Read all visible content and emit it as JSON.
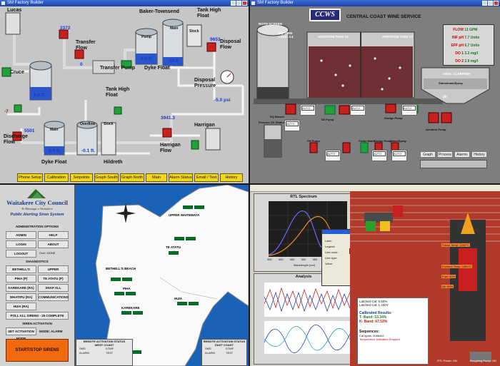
{
  "pane1": {
    "title": "SM Factory Builder",
    "labels": {
      "lucas": "Lucas",
      "baker": "Baker-Townsend",
      "tank_high_float_1": "Tank High\nFloat",
      "transfer_flow": "Transfer\nFlow",
      "disposal_flow": "Disposal\nFlow",
      "cruce": "Cruce",
      "transfer_pump": "Transfer Pump",
      "dyke_float_1": "Dyke Float",
      "tank_high_float_2": "Tank High\nFloat",
      "disposal_pressure": "Disposal\nPressure",
      "harrigan_flow": "Harrigan\nFlow",
      "harrigan": "Harrigan",
      "hildreth": "Hildreth",
      "discharge_flow": "Discharge\nFlow",
      "dyke_float_2": "Dyke Float",
      "main_1": "Main",
      "main_2": "Main",
      "overflow": "Overflow",
      "stock_1": "Stock",
      "stock_2": "Stock",
      "pump": "Pump"
    },
    "values": {
      "v2372": "2372",
      "v0": "0",
      "v9653": "9653",
      "v56": "5.6 ft.",
      "v60": "6.0 ft.",
      "v106": "10.6",
      "vneg50": "-5.0 psi",
      "v3941": "3941.3",
      "v5501": "5501",
      "v59": "5.9 ft.",
      "vneg01": "-0.1 ft.",
      "vneg7": "-7"
    },
    "buttons": [
      "Phone Setup",
      "Calibration",
      "Setpoints",
      "Graph South",
      "Graph North",
      "Main",
      "Alarm Status",
      "Email / Text",
      "History"
    ]
  },
  "pane2": {
    "title": "SM Factory Builder",
    "logo": "CCWS",
    "brand": "CENTRAL COAST WINE SERVICE",
    "tags": {
      "roto": "ROTO-SCREEN",
      "eq": "EQ TANK\nLevel: 3.4",
      "aer1": "AERATION TANK #1",
      "aer2": "AERATION TANK #2",
      "clarifier": "FINAL CLARIFIER",
      "sidestream": "Sidestream/Spray",
      "ph": "ph",
      "eq_blower": "EQ Blower",
      "proc_ox": "Process OX Station",
      "nit_pump": "N/I Pump",
      "sludge_pump": "Sludge Pump",
      "ph_pump": "PH Pump",
      "probe_maint": "Probe Maint",
      "sludge_pump2": "Sludge Pump",
      "slime_spray": "Slime/Spray",
      "aer_pump": "Aeration Pump"
    },
    "readings": [
      {
        "label": "FLOW",
        "value": "11 GPM"
      },
      {
        "label": "INF pH",
        "value": "7.7 Units"
      },
      {
        "label": "EFF pH",
        "value": "6.7 Units"
      },
      {
        "label": "DO 1",
        "value": "3.3 mg/l"
      },
      {
        "label": "DO 2",
        "value": "2.9 mg/l"
      }
    ],
    "nav": [
      "Graph",
      "Process",
      "Alarms",
      "History"
    ],
    "auto": "AUTO"
  },
  "pane3": {
    "org": "Waitakere City Council",
    "org_sub": "Te Rūnanga o Waitakere",
    "system": "Public Alerting Siren System",
    "admin_title": "ADMINISTRATION OPTIONS",
    "admin_buttons": [
      "ADMIN",
      "HELP",
      "LOGIN",
      "ABOUT",
      "LOGOUT",
      "Over: NONE"
    ],
    "diag_title": "DIAGNOSTICS",
    "diag_buttons": [
      "BETHELL'S BEACH (P)",
      "UPPER WAITEMATA (P)",
      "PIHA (P)",
      "TE ATATU (P)",
      "KAREKARE (RA)",
      "SNAP ALL",
      "WHATIPU (RA)",
      "COMMUNICATIONS",
      "HUIA (RA)",
      "POLL ALL SIRENS - 25 COMPLETE"
    ],
    "siren_title": "SIREN ACTIVATION",
    "siren_buttons": [
      "SET ACTIVATION MODE",
      "MODE: ALARM"
    ],
    "start": "START/STOP SIRENS",
    "towns": [
      "UPPER WAITEMATA",
      "TE ATATU",
      "BETHELL'S BEACH",
      "PIHA",
      "KAREKARE",
      "HUIA",
      "WHATIPU"
    ],
    "remote_west": "REMOTE ACTIVATION STATUS\nWEST COAST",
    "remote_east": "REMOTE ACTIVATION STATUS\nEAST COAST",
    "remote_rows": [
      "SMS",
      "DTMF",
      "ALARM",
      "TEST"
    ]
  },
  "pane4": {
    "title1": "RTL Spectrum",
    "axis1": "Wavelength (nm)",
    "x1": [
      "350",
      "400",
      "450",
      "500",
      "550",
      "600",
      "650",
      "700"
    ],
    "title2": "Analysis",
    "results_title": "Calibrated Results:",
    "results": [
      "T- Band: 53.34%",
      "K- Band: 67.53%"
    ],
    "sequences": "Sequences:",
    "seq_lines": [
      "Cal Ignite: 3088462",
      "Temperature Indication Stopped"
    ],
    "latched": [
      "Latched Cal: 5.50%",
      "Latched Cal: 1.432V"
    ],
    "labels_r": [
      "Flame Temp: 1350°C",
      "Furnace Temp: 1850°C",
      "Fuel: 40%",
      "Air: 60%"
    ],
    "status_bottom": [
      "RTL Power: ON",
      "Roughing Pump: ON"
    ],
    "props": [
      "Lake:",
      "Legend:",
      "Line color:",
      "Line type:",
      "Value:"
    ]
  }
}
